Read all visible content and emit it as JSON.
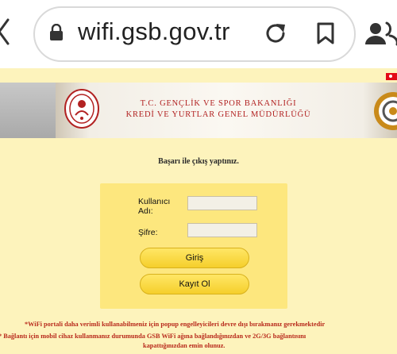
{
  "browser": {
    "url": "wifi.gsb.gov.tr",
    "icons": [
      "back-chevron-icon",
      "lock-icon",
      "reload-icon",
      "bookmark-icon",
      "people-icon"
    ]
  },
  "header": {
    "line1": "T.C. GENÇLİK VE SPOR BAKANLIĞI",
    "line2": "KREDİ VE YURTLAR GENEL MÜDÜRLÜĞÜ"
  },
  "message": "Başarı ile çıkış yaptınız.",
  "form": {
    "username_label": "Kullanıcı Adı:",
    "username_value": "",
    "password_label": "Şifre:",
    "password_value": "",
    "login_label": "Giriş",
    "register_label": "Kayıt Ol"
  },
  "notes": {
    "line1": "*WiFi portali daha verimli kullanabilmeniz için popup engelleyicileri devre dışı bırakmanız gerekmektedir",
    "line2": "* Bağlantı için mobil cihaz kullanmanız durumunda GSB WiFi ağına bağlandığınızdan ve 2G/3G bağlantısını",
    "line3": "kapattığınızdan emin olunuz."
  },
  "colors": {
    "page_bg": "#fdf3bc",
    "panel_bg": "#fde77e",
    "button": "#f5cf2b",
    "header_text": "#b22222",
    "note_text": "#b82a1c",
    "flag": "#e30a17"
  }
}
